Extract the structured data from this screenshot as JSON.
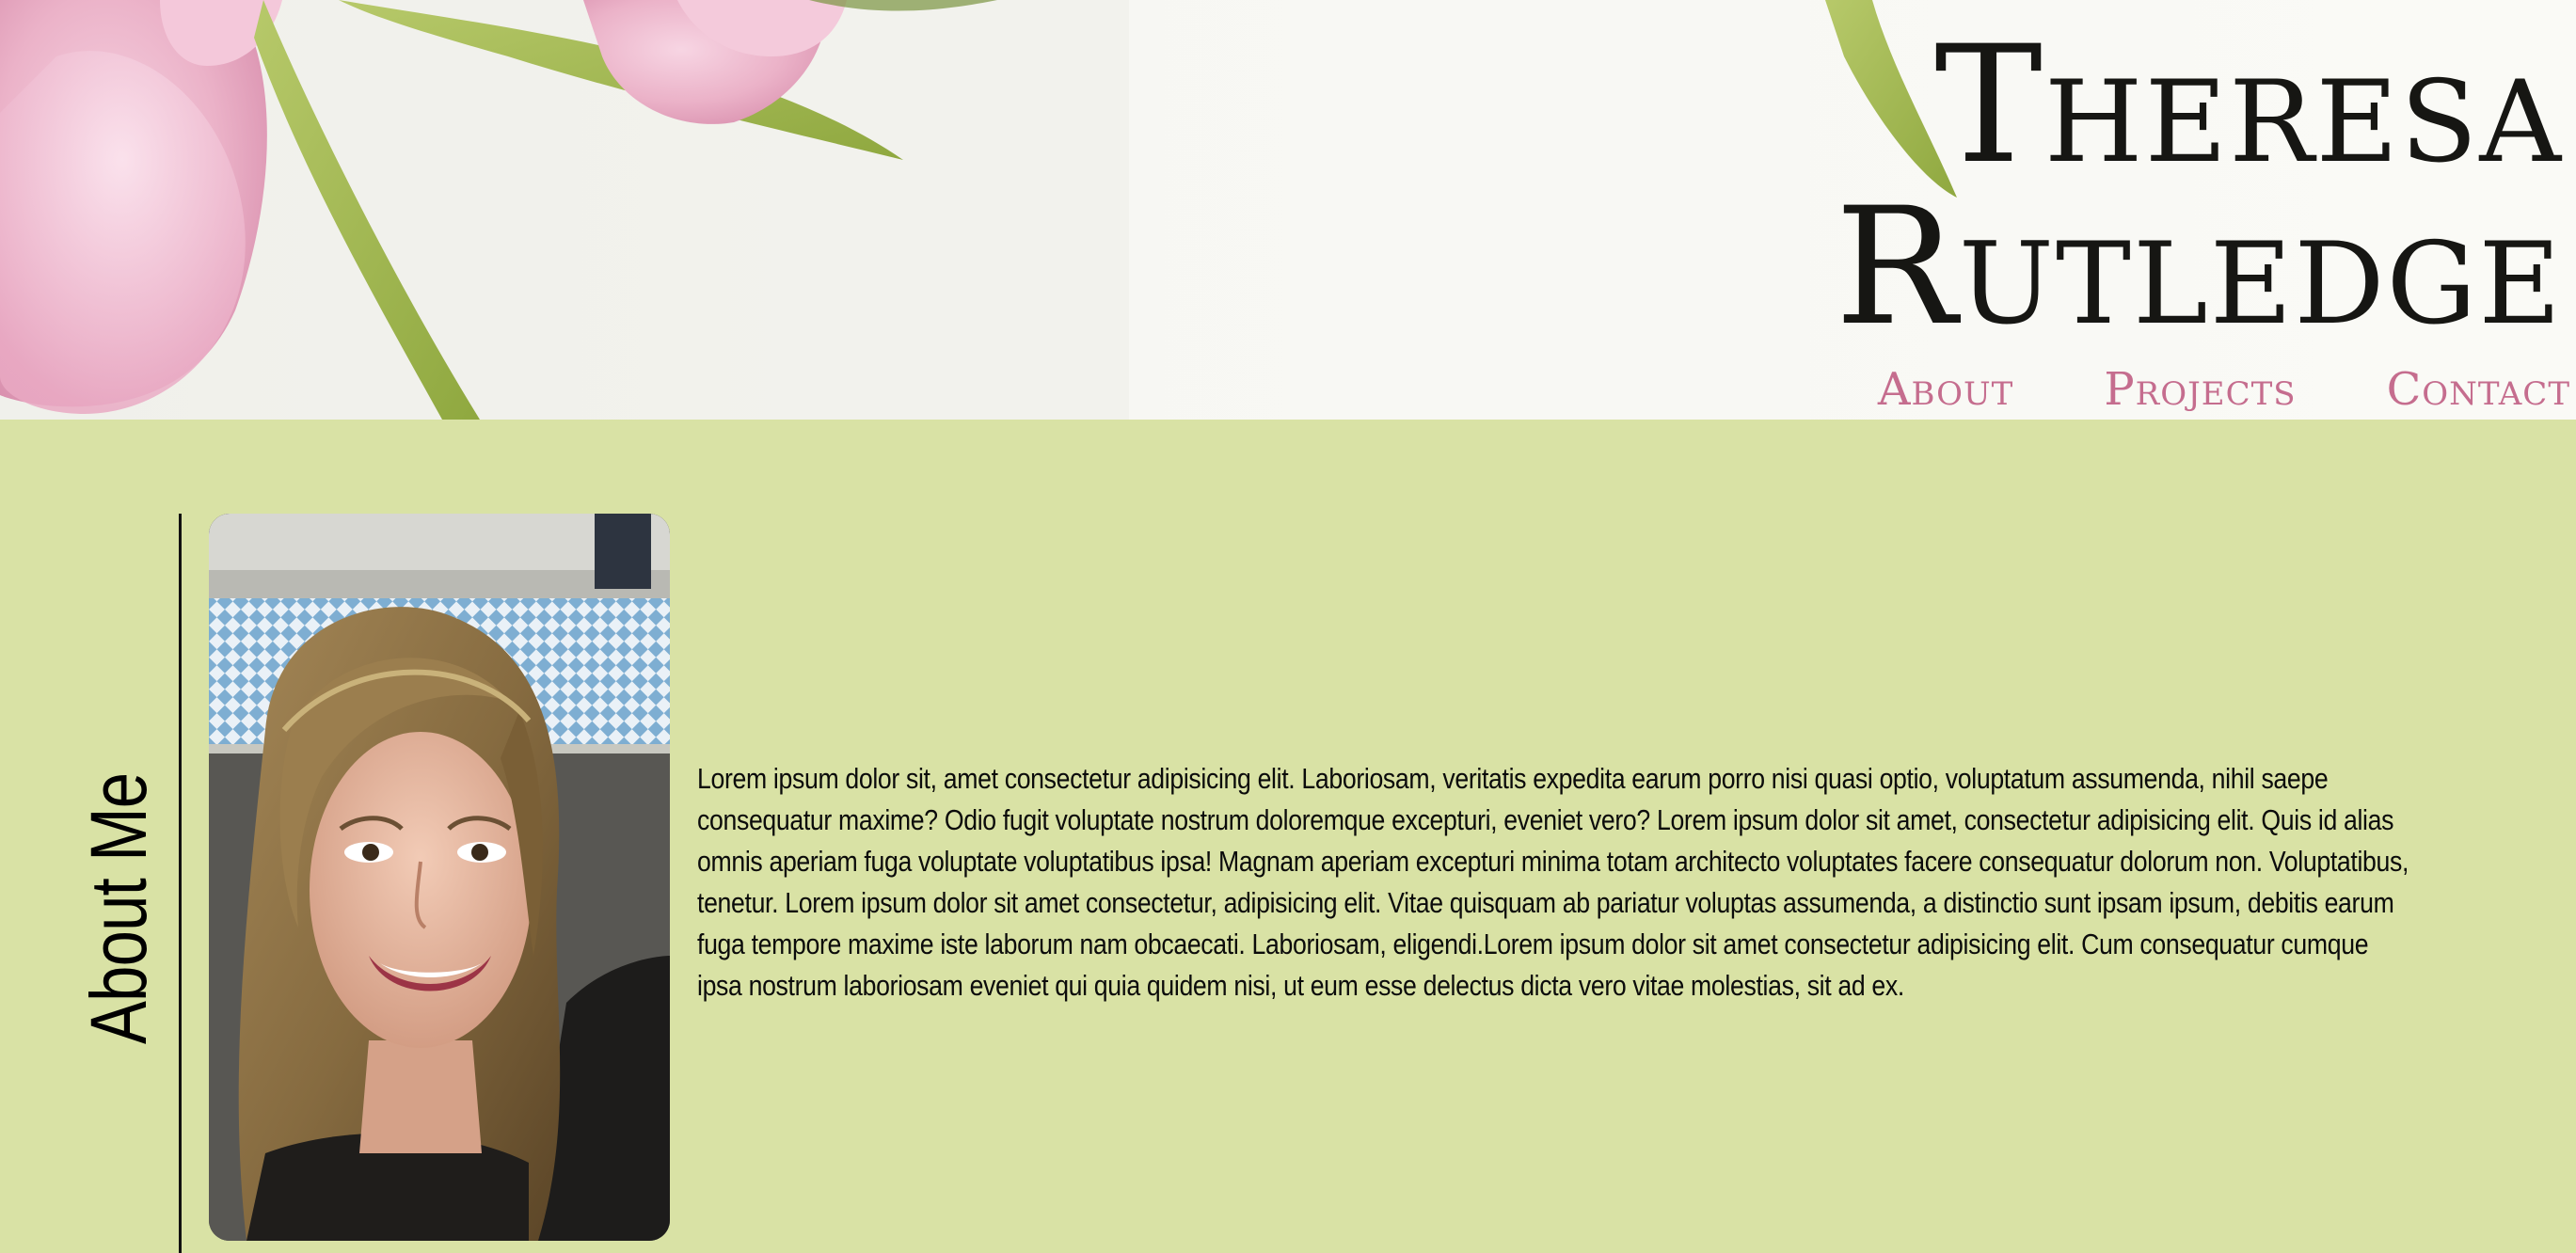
{
  "header": {
    "title_line1": "Theresa",
    "title_line2": "Rutledge"
  },
  "nav": {
    "items": [
      {
        "label": "About"
      },
      {
        "label": "Projects"
      },
      {
        "label": "Contact"
      }
    ]
  },
  "about": {
    "heading": "About Me",
    "bio": "Lorem ipsum dolor sit, amet consectetur adipisicing elit. Laboriosam, veritatis expedita earum porro nisi quasi optio, voluptatum assumenda, nihil saepe consequatur maxime? Odio fugit voluptate nostrum doloremque excepturi, eveniet vero? Lorem ipsum dolor sit amet, consectetur adipisicing elit. Quis id alias omnis aperiam fuga voluptate voluptatibus ipsa! Magnam aperiam excepturi minima totam architecto voluptates facere consequatur dolorum non. Voluptatibus, tenetur. Lorem ipsum dolor sit amet consectetur, adipisicing elit. Vitae quisquam ab pariatur voluptas assumenda, a distinctio sunt ipsam ipsum, debitis earum fuga tempore maxime iste laborum nam obcaecati. Laboriosam, eligendi.Lorem ipsum dolor sit amet consectetur adipisicing elit. Cum consequatur cumque ipsa nostrum laboriosam eveniet qui quia quidem nisi, ut eum esse delectus dicta vero vitae molestias, sit ad ex."
  },
  "colors": {
    "section_background": "#d9e2a5",
    "nav_link": "#c56d8e",
    "title_text": "#161613"
  }
}
